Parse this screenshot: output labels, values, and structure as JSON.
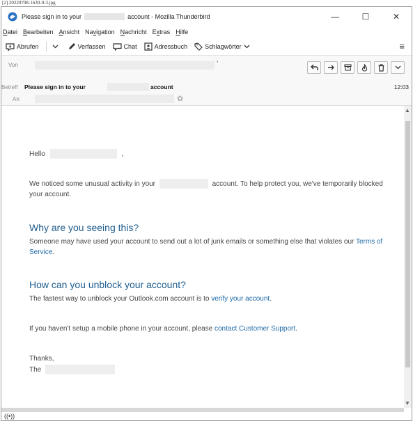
{
  "caption": "[2] 20220708-1630-0-3.jpg",
  "window": {
    "title_prefix": "Please sign in to your",
    "title_suffix": "account - Mozilla Thunderbird",
    "minimize": "—",
    "maximize": "☐",
    "close": "✕"
  },
  "menu": [
    {
      "underline": "D",
      "rest": "atei"
    },
    {
      "underline": "B",
      "rest": "earbeiten"
    },
    {
      "underline": "A",
      "rest": "nsicht"
    },
    {
      "pre": "Na",
      "underline": "v",
      "rest": "igation"
    },
    {
      "underline": "N",
      "rest": "achricht"
    },
    {
      "pre": "E",
      "underline": "x",
      "rest": "tras"
    },
    {
      "underline": "H",
      "rest": "ilfe"
    }
  ],
  "toolbar": {
    "get_messages": "Abrufen",
    "write": "Verfassen",
    "chat": "Chat",
    "address_book": "Adressbuch",
    "tags": "Schlagwörter",
    "app_menu": "≡"
  },
  "header": {
    "from_label": "Von",
    "subject_label": "Betreff",
    "to_label": "An",
    "subject_prefix": "Please sign in to your",
    "subject_suffix": "account",
    "time": "12:03"
  },
  "email": {
    "greeting": "Hello",
    "greeting_end": ",",
    "para1_a": "We noticed some unusual activity in your",
    "para1_b": "account. To help protect you, we've temporarily blocked your account.",
    "heading1": "Why are you seeing this?",
    "para2_a": "Someone may have used your account to send out a lot of junk emails or something else that violates our",
    "para2_link": "Terms of Service",
    "para2_end": ".",
    "heading2": "How can you unblock your account?",
    "para3_a": "The fastest way to unblock your Outlook.com account is to",
    "para3_link": "verify your account",
    "para3_end": ".",
    "para4_a": "If you haven't setup a mobile phone in your account, please",
    "para4_link": "contact Customer Support",
    "para4_end": ".",
    "signoff": "Thanks,",
    "signature_prefix": "The"
  },
  "status": {
    "activity_icon": "((•))"
  }
}
